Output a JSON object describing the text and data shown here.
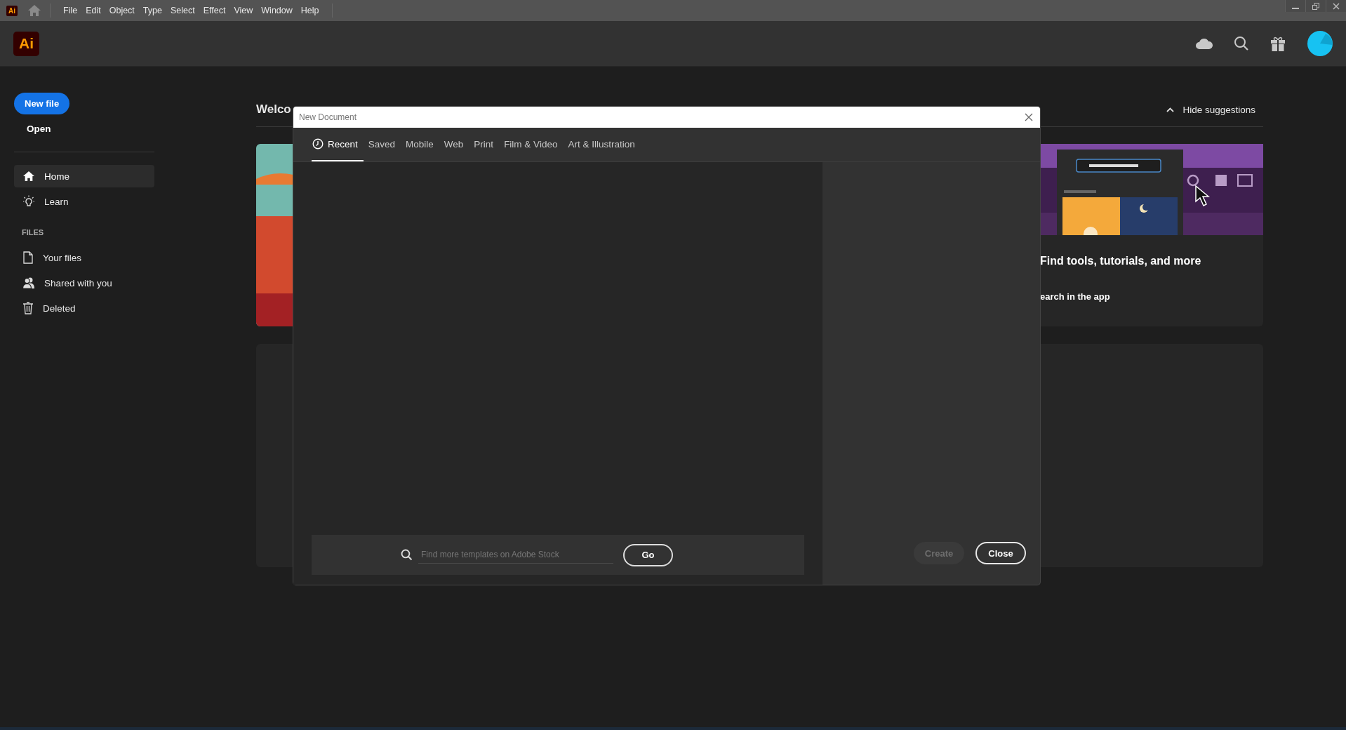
{
  "menu_bar": {
    "logo": "Ai",
    "items": [
      "File",
      "Edit",
      "Object",
      "Type",
      "Select",
      "Effect",
      "View",
      "Window",
      "Help"
    ]
  },
  "header": {
    "logo": "Ai"
  },
  "sidebar": {
    "new_file": "New file",
    "open": "Open",
    "nav": [
      {
        "label": "Home",
        "selected": true
      },
      {
        "label": "Learn",
        "selected": false
      }
    ],
    "section": "FILES",
    "files": [
      {
        "label": "Your files",
        "selected": false
      },
      {
        "label": "Shared with you",
        "selected": false
      },
      {
        "label": "Deleted",
        "selected": false
      }
    ]
  },
  "home": {
    "title": "Welco",
    "hide_suggestions": "Hide suggestions",
    "suggestion": {
      "title": "Find tools, tutorials, and more",
      "link": "earch in the app"
    }
  },
  "dialog": {
    "title": "New Document",
    "tabs": [
      {
        "label": "Recent",
        "selected": true
      },
      {
        "label": "Saved",
        "selected": false
      },
      {
        "label": "Mobile",
        "selected": false
      },
      {
        "label": "Web",
        "selected": false
      },
      {
        "label": "Print",
        "selected": false
      },
      {
        "label": "Film & Video",
        "selected": false
      },
      {
        "label": "Art & Illustration",
        "selected": false
      }
    ],
    "search": {
      "placeholder": "Find more templates on Adobe Stock",
      "button": "Go"
    },
    "buttons": [
      {
        "label": "Create",
        "disabled": true
      },
      {
        "label": "Close",
        "disabled": false
      }
    ]
  }
}
